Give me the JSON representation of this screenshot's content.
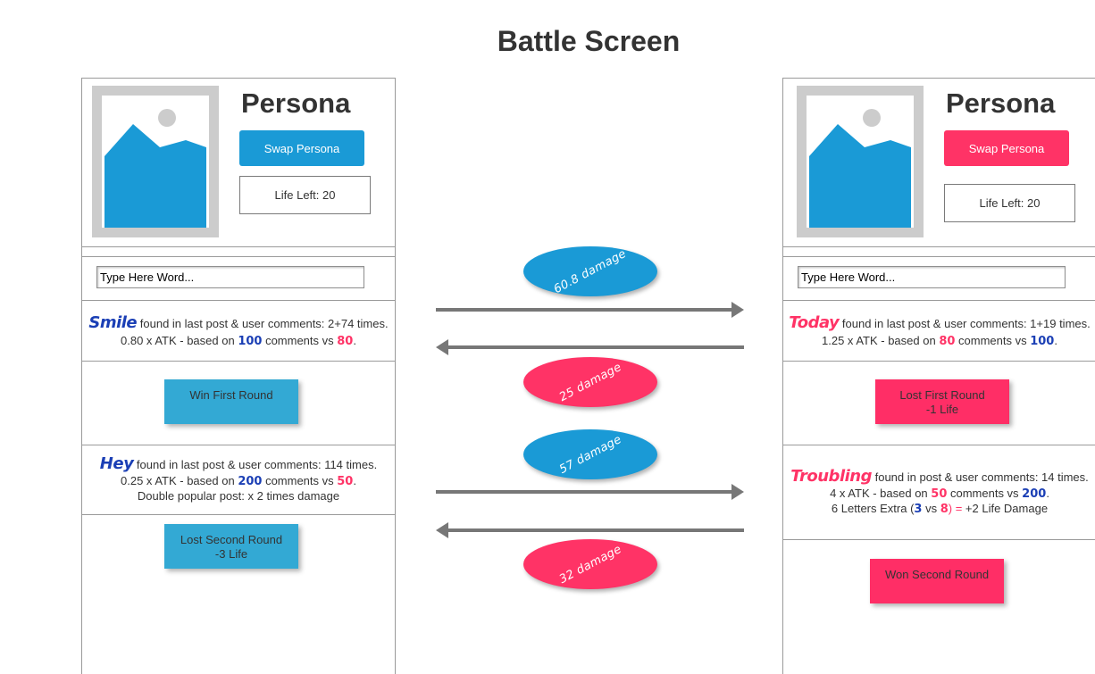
{
  "page": {
    "title": "Battle Screen"
  },
  "colors": {
    "blue_accent": "#1a9ad6",
    "pink_accent": "#ff3366",
    "blue_result": "#33a9d4",
    "pink_result": "#ff2e66",
    "word_blue": "#1b3fb5",
    "word_pink": "#ff3366",
    "arrow": "#777777"
  },
  "left": {
    "persona_title": "Persona",
    "image_icon": "image-placeholder-icon",
    "swap_label": "Swap Persona",
    "life_left": "Life Left: 20",
    "input_placeholder": "Type Here Word...",
    "round1": {
      "word": "Smile",
      "line1_rest": " found in last post & user comments: 2+74 times.",
      "line2_pre": "0.80 x ATK - based on ",
      "line2_num1": "100",
      "line2_mid": " comments vs ",
      "line2_num2": "80",
      "line2_end": ".",
      "result_line1": "Win First Round",
      "result_line2": ""
    },
    "round2": {
      "word": "Hey",
      "line1_rest": " found in last post & user comments: 114 times.",
      "line2_pre": "0.25 x ATK - based on ",
      "line2_num1": "200",
      "line2_mid": " comments vs ",
      "line2_num2": "50",
      "line2_end": ".",
      "line3": "Double popular post: x 2 times damage",
      "result_line1": "Lost Second Round",
      "result_line2": "-3 Life"
    }
  },
  "right": {
    "persona_title": "Persona",
    "image_icon": "image-placeholder-icon",
    "swap_label": "Swap Persona",
    "life_left": "Life Left: 20",
    "input_placeholder": "Type Here Word...",
    "round1": {
      "word": "Today",
      "line1_rest": " found in last post & user comments: 1+19 times.",
      "line2_pre": "1.25 x ATK - based on ",
      "line2_num1": "80",
      "line2_mid": " comments vs ",
      "line2_num2": "100",
      "line2_end": ".",
      "result_line1": "Lost First Round",
      "result_line2": "-1 Life"
    },
    "round2": {
      "word": "Troubling",
      "line1_rest": " found in post & user comments: 14 times.",
      "line2_pre": "4 x ATK - based on ",
      "line2_num1": "50",
      "line2_mid": " comments vs ",
      "line2_num2": "200",
      "line2_end": ".",
      "line3_pre": "6 Letters Extra (",
      "line3_num1": "3",
      "line3_mid": " vs ",
      "line3_num2": "8",
      "line3_paren": ")",
      "line3_eq": " = ",
      "line3_end": " +2 Life Damage",
      "result_line1": "Won Second Round",
      "result_line2": ""
    }
  },
  "middle": {
    "damage1": "60.8 damage",
    "damage2": "25 damage",
    "damage3": "57 damage",
    "damage4": "32 damage"
  }
}
